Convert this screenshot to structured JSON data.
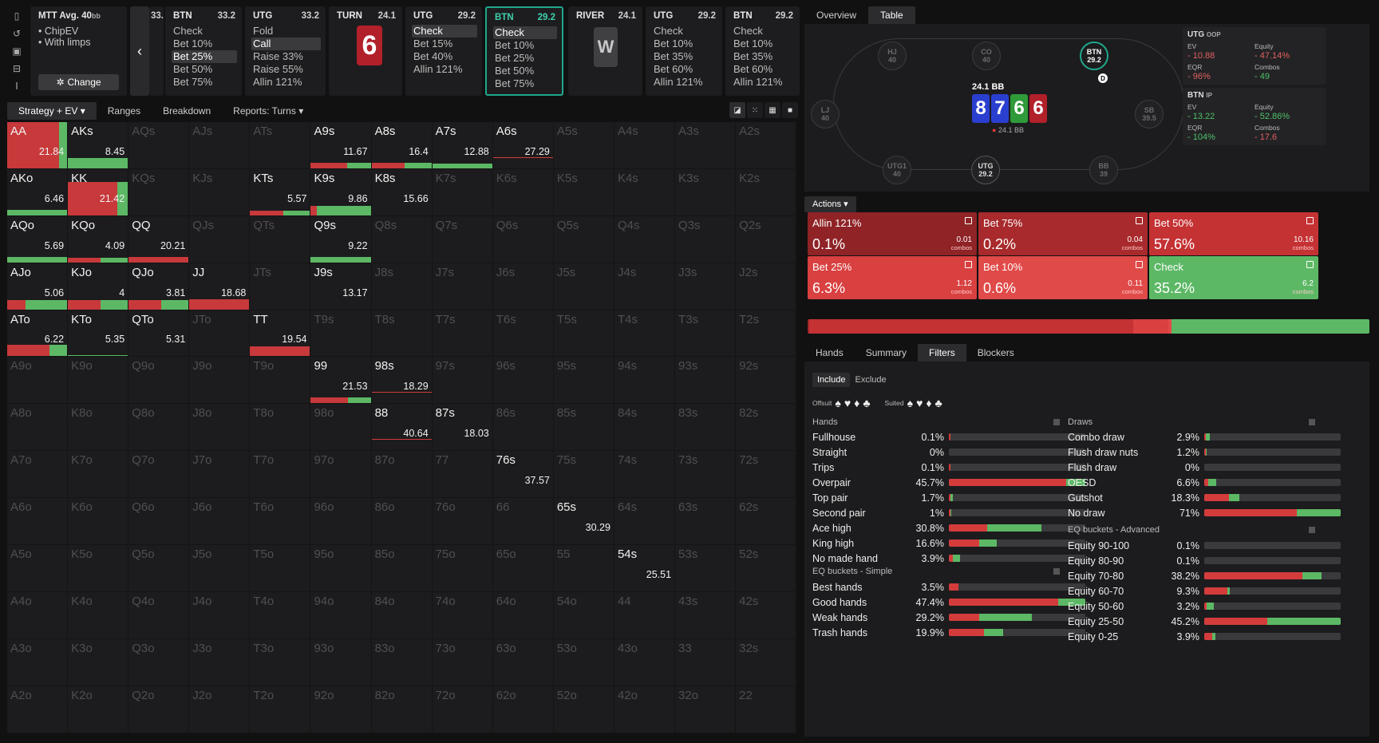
{
  "tool": {
    "icons": [
      "bookmark-icon",
      "history-icon",
      "save-icon",
      "gamepad-icon",
      "text-cursor-icon"
    ]
  },
  "mtt": {
    "title": "MTT",
    "avg": "Avg. 40",
    "unit": "bb",
    "opt1": "ChipEV",
    "opt2": "With limps",
    "change": "Change"
  },
  "partial_card": {
    "bb": "33.2"
  },
  "cards": [
    {
      "pos": "BTN",
      "bb": "33.2",
      "acts": [
        "Check",
        "Bet 10%",
        "Bet 25%",
        "Bet 50%",
        "Bet 75%"
      ],
      "sel": 2
    },
    {
      "pos": "UTG",
      "bb": "33.2",
      "acts": [
        "Fold",
        "Call",
        "Raise 33%",
        "Raise 55%",
        "Allin 121%"
      ],
      "sel": 1
    },
    {
      "pos": "TURN",
      "bb": "24.1",
      "acts": [],
      "card": "6"
    },
    {
      "pos": "UTG",
      "bb": "29.2",
      "acts": [
        "Check",
        "Bet 15%",
        "Bet 40%",
        "Allin 121%"
      ],
      "sel": 0
    },
    {
      "pos": "BTN",
      "bb": "29.2",
      "acts": [
        "Check",
        "Bet 10%",
        "Bet 25%",
        "Bet 50%",
        "Bet 75%"
      ],
      "sel": 0,
      "active": true
    },
    {
      "pos": "RIVER",
      "bb": "24.1",
      "acts": [],
      "card": "W"
    },
    {
      "pos": "UTG",
      "bb": "29.2",
      "acts": [
        "Check",
        "Bet 10%",
        "Bet 35%",
        "Bet 60%",
        "Allin 121%"
      ]
    },
    {
      "pos": "BTN",
      "bb": "29.2",
      "acts": [
        "Check",
        "Bet 10%",
        "Bet 35%",
        "Bet 60%",
        "Allin 121%"
      ]
    }
  ],
  "left_tabs": [
    "Strategy + EV",
    "Ranges",
    "Breakdown",
    "Reports: Turns"
  ],
  "ranks": [
    "A",
    "K",
    "Q",
    "J",
    "T",
    "9",
    "8",
    "7",
    "6",
    "5",
    "4",
    "3",
    "2"
  ],
  "grid_cells": [
    {
      "h": "AA",
      "v": "21.84",
      "r": 0.87,
      "g": 0.13,
      "f": 1.0
    },
    {
      "h": "AKs",
      "v": "8.45",
      "r": 0,
      "g": 1,
      "f": 0.22
    },
    {
      "h": "A9s",
      "v": "11.67",
      "r": 0.6,
      "g": 0.4,
      "f": 0.12
    },
    {
      "h": "A8s",
      "v": "16.4",
      "r": 0.55,
      "g": 0.45,
      "f": 0.12
    },
    {
      "h": "A7s",
      "v": "12.88",
      "r": 0,
      "g": 1,
      "f": 0.1
    },
    {
      "h": "A6s",
      "v": "27.29",
      "u": true
    },
    {
      "h": "AKo",
      "v": "6.46",
      "r": 0,
      "g": 1,
      "f": 0.12
    },
    {
      "h": "KK",
      "v": "21.42",
      "r": 0.82,
      "g": 0.18,
      "f": 0.72
    },
    {
      "h": "KTs",
      "v": "5.57",
      "r": 0.55,
      "g": 0.45,
      "f": 0.1
    },
    {
      "h": "K9s",
      "v": "9.86",
      "r": 0.1,
      "g": 0.9,
      "f": 0.2
    },
    {
      "h": "K8s",
      "v": "15.66"
    },
    {
      "h": "AQo",
      "v": "5.69",
      "r": 0,
      "g": 1,
      "f": 0.12
    },
    {
      "h": "KQo",
      "v": "4.09",
      "r": 0.55,
      "g": 0.45,
      "f": 0.1
    },
    {
      "h": "QQ",
      "v": "20.21",
      "r": 1,
      "g": 0,
      "f": 0.12
    },
    {
      "h": "Q9s",
      "v": "9.22",
      "r": 0,
      "g": 1,
      "f": 0.12
    },
    {
      "h": "AJo",
      "v": "5.06",
      "r": 0.3,
      "g": 0.7,
      "f": 0.2
    },
    {
      "h": "KJo",
      "v": "4",
      "r": 0.55,
      "g": 0.45,
      "f": 0.2
    },
    {
      "h": "QJo",
      "v": "3.81",
      "r": 0.55,
      "g": 0.45,
      "f": 0.2
    },
    {
      "h": "JJ",
      "v": "18.68",
      "r": 1,
      "g": 0,
      "f": 0.22
    },
    {
      "h": "J9s",
      "v": "13.17"
    },
    {
      "h": "ATo",
      "v": "6.22",
      "r": 0.7,
      "g": 0.3,
      "f": 0.25
    },
    {
      "h": "KTo",
      "v": "5.35",
      "r": 0,
      "g": 1,
      "f": 0.03
    },
    {
      "h": "QTo",
      "v": "5.31"
    },
    {
      "h": "TT",
      "v": "19.54",
      "r": 1,
      "g": 0,
      "f": 0.22
    },
    {
      "h": "99",
      "v": "21.53",
      "r": 0.62,
      "g": 0.38,
      "f": 0.12
    },
    {
      "h": "98s",
      "v": "18.29",
      "u": true
    },
    {
      "h": "88",
      "v": "40.64",
      "u": true
    },
    {
      "h": "87s",
      "v": "18.03"
    },
    {
      "h": "76s",
      "v": "37.57"
    },
    {
      "h": "65s",
      "v": "30.29"
    },
    {
      "h": "54s",
      "v": "25.51"
    }
  ],
  "right_tabs": [
    "Overview",
    "Table"
  ],
  "table": {
    "seats": [
      {
        "n": "HJ",
        "b": "40"
      },
      {
        "n": "CO",
        "b": "40"
      },
      {
        "n": "BTN",
        "b": "29.2"
      },
      {
        "n": "LJ",
        "b": "40"
      },
      {
        "n": "SB",
        "b": "39.5"
      },
      {
        "n": "UTG1",
        "b": "40"
      },
      {
        "n": "UTG",
        "b": "29.2"
      },
      {
        "n": "BB",
        "b": "39"
      }
    ],
    "dealer": "D",
    "pot": "24.1 BB",
    "board": [
      "8",
      "7",
      "6",
      "6"
    ],
    "board_colors": [
      "#2a3fd0",
      "#2a3fd0",
      "#2f9a3a",
      "#b2202a"
    ],
    "chips": "24.1 BB"
  },
  "stats": [
    {
      "pos": "UTG",
      "tag": "OOP",
      "items": [
        {
          "k": "EV",
          "v": "- 10.88",
          "c": "r"
        },
        {
          "k": "Equity",
          "v": "- 47.14%",
          "c": "r"
        },
        {
          "k": "EQR",
          "v": "- 96%",
          "c": "r"
        },
        {
          "k": "Combos",
          "v": "- 49",
          "c": "g"
        }
      ]
    },
    {
      "pos": "BTN",
      "tag": "IP",
      "items": [
        {
          "k": "EV",
          "v": "- 13.22",
          "c": "g"
        },
        {
          "k": "Equity",
          "v": "- 52.86%",
          "c": "g"
        },
        {
          "k": "EQR",
          "v": "- 104%",
          "c": "g"
        },
        {
          "k": "Combos",
          "v": "- 17.6",
          "c": "r"
        }
      ]
    }
  ],
  "actions_label": "Actions",
  "actions": [
    {
      "n": "Allin 121%",
      "p": "0.1%",
      "c": "0.01",
      "u": "combos",
      "col": "#8f2326"
    },
    {
      "n": "Bet 75%",
      "p": "0.2%",
      "c": "0.04",
      "u": "combos",
      "col": "#a82a2c"
    },
    {
      "n": "Bet 50%",
      "p": "57.6%",
      "c": "10.16",
      "u": "combos",
      "col": "#c53234"
    },
    {
      "n": "Bet 25%",
      "p": "6.3%",
      "c": "1.12",
      "u": "combos",
      "col": "#d94040"
    },
    {
      "n": "Bet 10%",
      "p": "0.6%",
      "c": "0.11",
      "u": "combos",
      "col": "#e04a48"
    },
    {
      "n": "Check",
      "p": "35.2%",
      "c": "6.2",
      "u": "combos",
      "col": "#5cb865"
    }
  ],
  "freq": [
    {
      "w": 0.1,
      "c": "#8f2326"
    },
    {
      "w": 0.2,
      "c": "#a82a2c"
    },
    {
      "w": 57.6,
      "c": "#c53234"
    },
    {
      "w": 6.3,
      "c": "#d94040"
    },
    {
      "w": 0.6,
      "c": "#e04a48"
    },
    {
      "w": 35.2,
      "c": "#5cb865"
    }
  ],
  "bottom_tabs": [
    "Hands",
    "Summary",
    "Filters",
    "Blockers"
  ],
  "filters": {
    "include": "Include",
    "exclude": "Exclude",
    "offsuit": "Offsuit",
    "suited": "Suited"
  },
  "hands_title": "Hands",
  "hands": [
    {
      "l": "Fullhouse",
      "p": "0.1%",
      "r": 0.01,
      "g": 0
    },
    {
      "l": "Straight",
      "p": "0%",
      "r": 0,
      "g": 0
    },
    {
      "l": "Trips",
      "p": "0.1%",
      "r": 0.01,
      "g": 0
    },
    {
      "l": "Overpair",
      "p": "45.7%",
      "r": 0.86,
      "g": 0.14
    },
    {
      "l": "Top pair",
      "p": "1.7%",
      "r": 0.01,
      "g": 0.02
    },
    {
      "l": "Second pair",
      "p": "1%",
      "r": 0.01,
      "g": 0.01
    },
    {
      "l": "Ace high",
      "p": "30.8%",
      "r": 0.28,
      "g": 0.4
    },
    {
      "l": "King high",
      "p": "16.6%",
      "r": 0.22,
      "g": 0.13
    },
    {
      "l": "No made hand",
      "p": "3.9%",
      "r": 0.03,
      "g": 0.05
    }
  ],
  "eq_simple_title": "EQ buckets - Simple",
  "eq_simple": [
    {
      "l": "Best hands",
      "p": "3.5%",
      "r": 0.07,
      "g": 0
    },
    {
      "l": "Good hands",
      "p": "47.4%",
      "r": 0.8,
      "g": 0.2
    },
    {
      "l": "Weak hands",
      "p": "29.2%",
      "r": 0.22,
      "g": 0.39
    },
    {
      "l": "Trash hands",
      "p": "19.9%",
      "r": 0.26,
      "g": 0.14
    }
  ],
  "draws_title": "Draws",
  "draws": [
    {
      "l": "Combo draw",
      "p": "2.9%",
      "r": 0.01,
      "g": 0.03
    },
    {
      "l": "Flush draw nuts",
      "p": "1.2%",
      "r": 0.01,
      "g": 0.01
    },
    {
      "l": "Flush draw",
      "p": "0%",
      "r": 0,
      "g": 0
    },
    {
      "l": "OESD",
      "p": "6.6%",
      "r": 0.03,
      "g": 0.06
    },
    {
      "l": "Gutshot",
      "p": "18.3%",
      "r": 0.18,
      "g": 0.08
    },
    {
      "l": "No draw",
      "p": "71%",
      "r": 0.68,
      "g": 0.32
    }
  ],
  "eq_adv_title": "EQ buckets - Advanced",
  "eq_adv": [
    {
      "l": "Equity 90-100",
      "p": "0.1%",
      "r": 0,
      "g": 0
    },
    {
      "l": "Equity 80-90",
      "p": "0.1%",
      "r": 0,
      "g": 0
    },
    {
      "l": "Equity 70-80",
      "p": "38.2%",
      "r": 0.72,
      "g": 0.14
    },
    {
      "l": "Equity 60-70",
      "p": "9.3%",
      "r": 0.17,
      "g": 0.02
    },
    {
      "l": "Equity 50-60",
      "p": "3.2%",
      "r": 0.02,
      "g": 0.05
    },
    {
      "l": "Equity 25-50",
      "p": "45.2%",
      "r": 0.46,
      "g": 0.54
    },
    {
      "l": "Equity 0-25",
      "p": "3.9%",
      "r": 0.06,
      "g": 0.02
    }
  ]
}
